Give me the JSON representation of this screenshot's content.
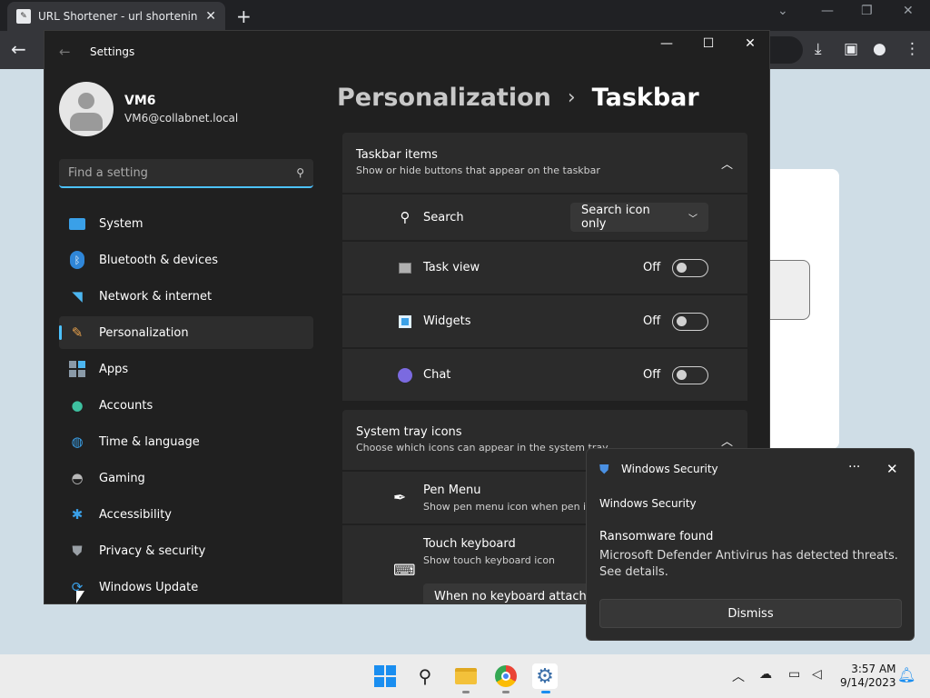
{
  "browser": {
    "tab_title": "URL Shortener - url shortening se",
    "tab_close": "✕",
    "new_tab": "+"
  },
  "settings": {
    "window_title": "Settings",
    "user": {
      "name": "VM6",
      "email": "VM6@collabnet.local"
    },
    "search_placeholder": "Find a setting",
    "nav": [
      {
        "label": "System",
        "icon": "monitor-icon"
      },
      {
        "label": "Bluetooth & devices",
        "icon": "bluetooth-icon"
      },
      {
        "label": "Network & internet",
        "icon": "wifi-icon"
      },
      {
        "label": "Personalization",
        "icon": "brush-icon",
        "active": true
      },
      {
        "label": "Apps",
        "icon": "apps-icon"
      },
      {
        "label": "Accounts",
        "icon": "person-icon"
      },
      {
        "label": "Time & language",
        "icon": "globe-clock-icon"
      },
      {
        "label": "Gaming",
        "icon": "gamepad-icon"
      },
      {
        "label": "Accessibility",
        "icon": "accessibility-icon"
      },
      {
        "label": "Privacy & security",
        "icon": "shield-icon"
      },
      {
        "label": "Windows Update",
        "icon": "update-icon"
      }
    ],
    "breadcrumb": {
      "parent": "Personalization",
      "separator": "›",
      "current": "Taskbar"
    },
    "taskbar_items": {
      "title": "Taskbar items",
      "subtitle": "Show or hide buttons that appear on the taskbar",
      "search": {
        "label": "Search",
        "value": "Search icon only"
      },
      "task_view": {
        "label": "Task view",
        "state": "Off"
      },
      "widgets": {
        "label": "Widgets",
        "state": "Off"
      },
      "chat": {
        "label": "Chat",
        "state": "Off"
      }
    },
    "system_tray": {
      "title": "System tray icons",
      "subtitle": "Choose which icons can appear in the system tray",
      "pen_menu": {
        "label": "Pen Menu",
        "subtitle": "Show pen menu icon when pen is"
      },
      "touch_keyboard": {
        "label": "Touch keyboard",
        "subtitle": "Show touch keyboard icon",
        "value": "When no keyboard attached"
      }
    }
  },
  "toast": {
    "app": "Windows Security",
    "more": "···",
    "sender": "Windows Security",
    "title": "Ransomware found",
    "body": "Microsoft Defender Antivirus has detected threats. See details.",
    "button": "Dismiss"
  },
  "clock": {
    "time": "3:57 AM",
    "date": "9/14/2023"
  },
  "colors": {
    "accent": "#4cc2ff",
    "window_bg": "#202020",
    "card_bg": "#2b2b2b",
    "taskbar_bg": "#ececec"
  }
}
